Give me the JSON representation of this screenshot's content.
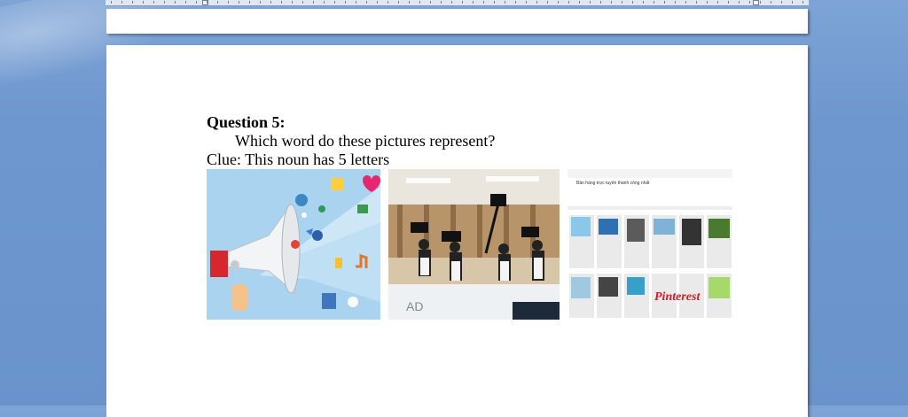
{
  "question": {
    "title": "Question 5:",
    "prompt": "Which word do these pictures represent?",
    "clue": "Clue: This noun has 5 letters"
  },
  "pictures": [
    {
      "depicts": "megaphone-with-social-media-icons"
    },
    {
      "depicts": "camera-crew-reporters"
    },
    {
      "depicts": "pinterest-board-screenshot",
      "header_text": "Bản hàng trực tuyến thành công nhất",
      "brand_text": "Pinterest"
    }
  ],
  "colors": {
    "desktop": "#6e97cf",
    "page": "#ffffff"
  }
}
